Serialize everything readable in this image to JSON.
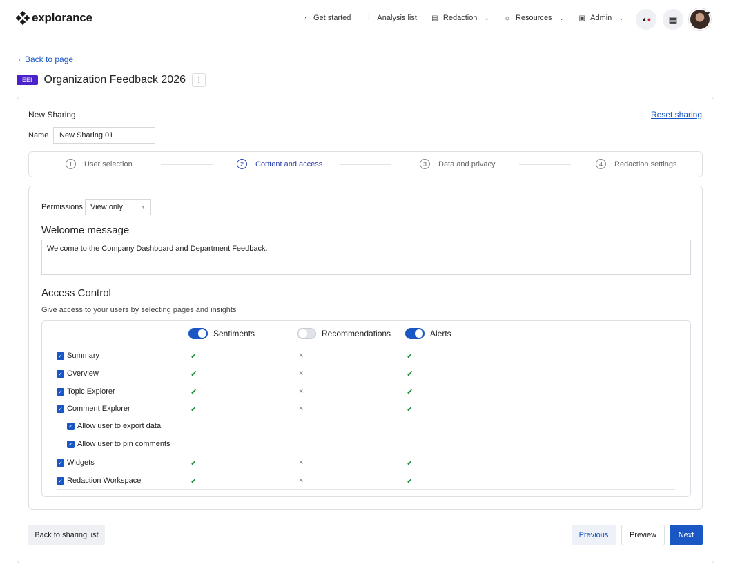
{
  "brand": {
    "name": "explorance"
  },
  "nav": {
    "items": [
      {
        "label": "Get started",
        "icon": "dashboard-icon",
        "glyph": "◔",
        "dropdown": false
      },
      {
        "label": "Analysis list",
        "icon": "list-icon",
        "glyph": "⁞",
        "dropdown": false
      },
      {
        "label": "Redaction",
        "icon": "document-icon",
        "glyph": "▤",
        "dropdown": true
      },
      {
        "label": "Resources",
        "icon": "lightbulb-icon",
        "glyph": "☼",
        "dropdown": true
      },
      {
        "label": "Admin",
        "icon": "briefcase-icon",
        "glyph": "▣",
        "dropdown": true
      }
    ]
  },
  "back_link": "Back to page",
  "page": {
    "badge": "EEI",
    "title": "Organization Feedback 2026"
  },
  "sharing": {
    "title": "New Sharing",
    "reset_label": "Reset sharing",
    "name_label": "Name",
    "name_value": "New Sharing 01"
  },
  "steps": [
    {
      "num": "1",
      "label": "User selection",
      "active": false
    },
    {
      "num": "2",
      "label": "Content and access",
      "active": true
    },
    {
      "num": "3",
      "label": "Data and privacy",
      "active": false
    },
    {
      "num": "4",
      "label": "Redaction settings",
      "active": false
    }
  ],
  "permissions": {
    "label": "Permissions",
    "value": "View only"
  },
  "welcome": {
    "heading": "Welcome message",
    "text": "Welcome to the Company Dashboard and Department Feedback."
  },
  "access": {
    "heading": "Access Control",
    "subtitle": "Give access to your users by selecting pages and insights",
    "toggles": [
      {
        "label": "Sentiments",
        "on": true
      },
      {
        "label": "Recommendations",
        "on": false
      },
      {
        "label": "Alerts",
        "on": true
      }
    ],
    "rows": [
      {
        "label": "Summary",
        "checked": true,
        "sub": false,
        "sentiments": "✔",
        "recommendations": "×",
        "alerts": "✔"
      },
      {
        "label": "Overview",
        "checked": true,
        "sub": false,
        "sentiments": "✔",
        "recommendations": "×",
        "alerts": "✔"
      },
      {
        "label": "Topic Explorer",
        "checked": true,
        "sub": false,
        "sentiments": "✔",
        "recommendations": "×",
        "alerts": "✔"
      },
      {
        "label": "Comment Explorer",
        "checked": true,
        "sub": false,
        "sentiments": "✔",
        "recommendations": "×",
        "alerts": "✔"
      },
      {
        "label": "Allow user to export data",
        "checked": true,
        "sub": true
      },
      {
        "label": "Allow user to pin comments",
        "checked": true,
        "sub": true
      },
      {
        "label": "Widgets",
        "checked": true,
        "sub": false,
        "sentiments": "✔",
        "recommendations": "×",
        "alerts": "✔"
      },
      {
        "label": "Redaction Workspace",
        "checked": true,
        "sub": false,
        "sentiments": "✔",
        "recommendations": "×",
        "alerts": "✔"
      }
    ]
  },
  "footer": {
    "back": "Back to sharing list",
    "previous": "Previous",
    "preview": "Preview",
    "next": "Next"
  },
  "colors": {
    "primary": "#1a56c4",
    "badge": "#4b21c9",
    "check": "#1e8a3a"
  }
}
